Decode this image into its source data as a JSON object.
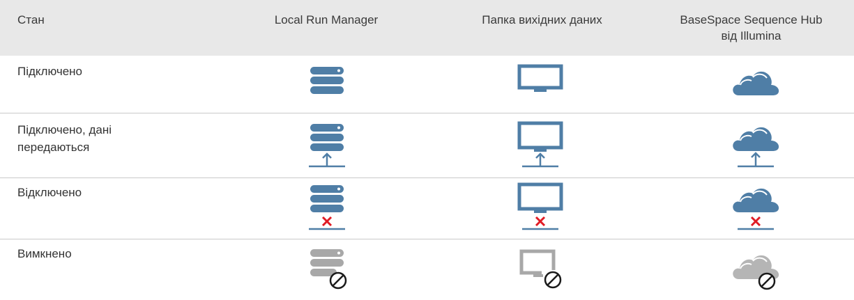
{
  "header": {
    "col_status": "Стан",
    "col_lrm": "Local Run Manager",
    "col_folder": "Папка вихідних даних",
    "col_basespace_line1": "BaseSpace Sequence Hub",
    "col_basespace_line2": "від Illumina"
  },
  "rows": [
    {
      "label_line1": "Підключено",
      "label_line2": "",
      "state": "connected"
    },
    {
      "label_line1": "Підключено, дані",
      "label_line2": "передаються",
      "state": "transferring"
    },
    {
      "label_line1": "Відключено",
      "label_line2": "",
      "state": "disconnected"
    },
    {
      "label_line1": "Вимкнено",
      "label_line2": "",
      "state": "off"
    }
  ],
  "icons": {
    "lrm": "server-icon",
    "folder": "monitor-icon",
    "basespace": "cloud-icon",
    "transfer": "upload-arrow-icon",
    "error": "red-x-icon",
    "disabled": "no-entry-icon"
  },
  "colors": {
    "icon_active": "#4f7ea6",
    "icon_disabled": "#a8a8a8",
    "error": "#e01b24",
    "header_bg": "#e8e8e8",
    "separator": "#c9c9c9"
  }
}
